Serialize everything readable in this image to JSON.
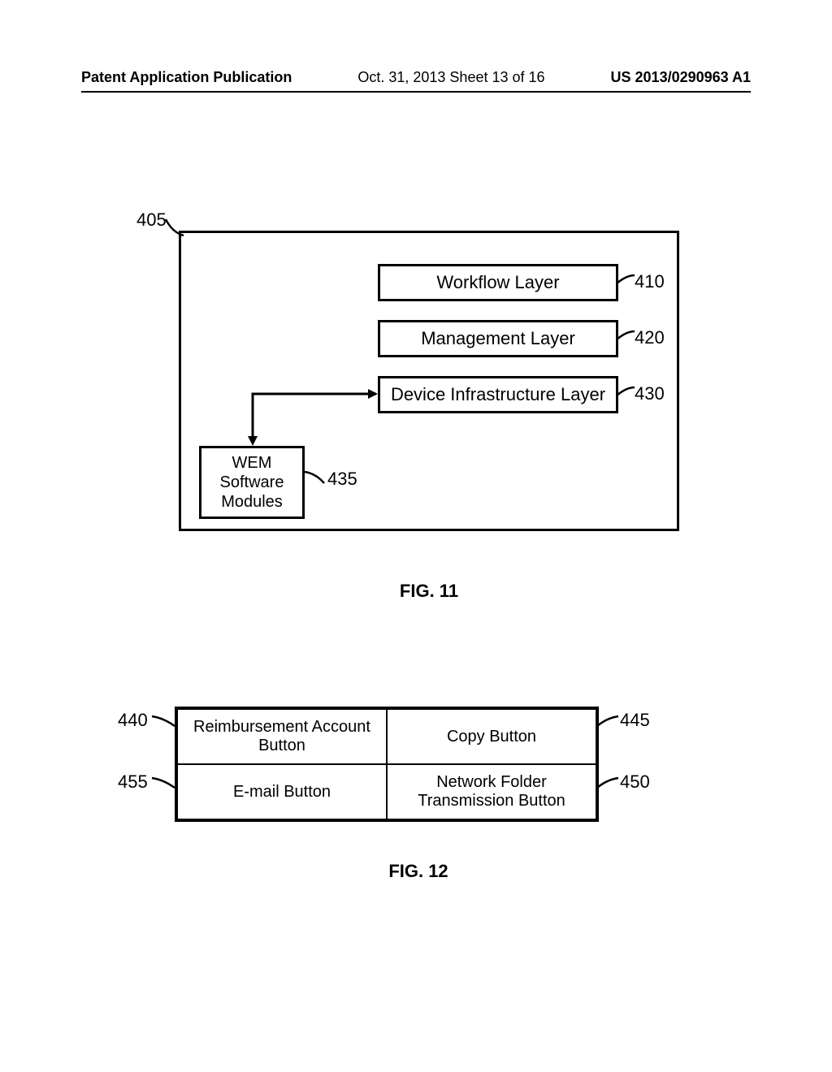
{
  "header": {
    "left": "Patent Application Publication",
    "mid": "Oct. 31, 2013  Sheet 13 of 16",
    "right": "US 2013/0290963 A1"
  },
  "fig11": {
    "caption": "FIG. 11",
    "outer_ref": "405",
    "layer_410": "Workflow Layer",
    "layer_420": "Management Layer",
    "layer_430": "Device Infrastructure Layer",
    "wem": "WEM\nSoftware\nModules",
    "ref_410": "410",
    "ref_420": "420",
    "ref_430": "430",
    "ref_435": "435"
  },
  "fig12": {
    "caption": "FIG. 12",
    "cell_440": "Reimbursement Account Button",
    "cell_445": "Copy Button",
    "cell_455": "E-mail Button",
    "cell_450": "Network Folder Transmission Button",
    "ref_440": "440",
    "ref_445": "445",
    "ref_455": "455",
    "ref_450": "450"
  }
}
